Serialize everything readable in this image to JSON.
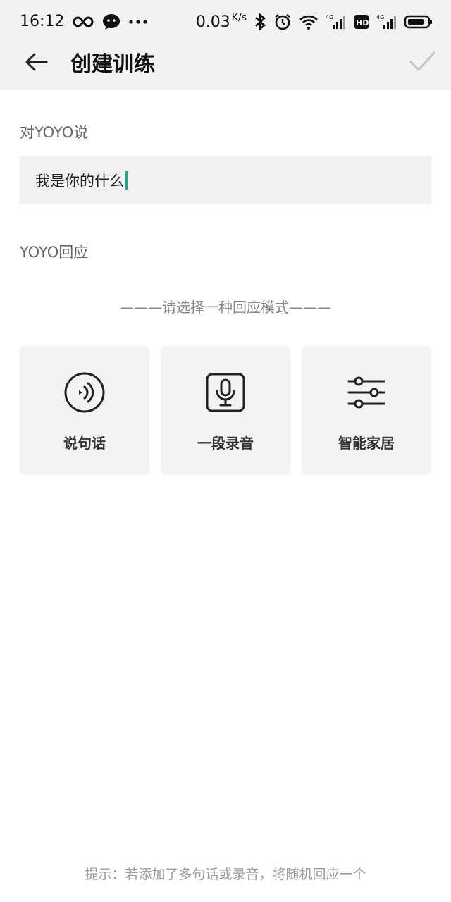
{
  "status_bar": {
    "time": "16:12",
    "speed_value": "0.03",
    "speed_unit": "K/s",
    "icons": [
      "infinity-icon",
      "wechat-icon",
      "more-icon",
      "bluetooth-icon",
      "alarm-icon",
      "wifi-icon",
      "4g-signal-icon",
      "hd-icon",
      "4g-signal-icon",
      "battery-icon"
    ]
  },
  "app_bar": {
    "title": "创建训练",
    "back_icon": "arrow-left-icon",
    "confirm_icon": "checkmark-icon"
  },
  "say_section": {
    "label": "对YOYO说",
    "input_value": "我是你的什么"
  },
  "response_section": {
    "label": "YOYO回应",
    "choose_mode_text": "———请选择一种回应模式———",
    "options": [
      {
        "label": "说句话",
        "icon": "sound-wave-icon"
      },
      {
        "label": "一段录音",
        "icon": "microphone-icon"
      },
      {
        "label": "智能家居",
        "icon": "sliders-icon"
      }
    ]
  },
  "hint": "提示：若添加了多句话或录音，将随机回应一个",
  "colors": {
    "caret": "#1aa894",
    "background": "#f2f2f2"
  }
}
